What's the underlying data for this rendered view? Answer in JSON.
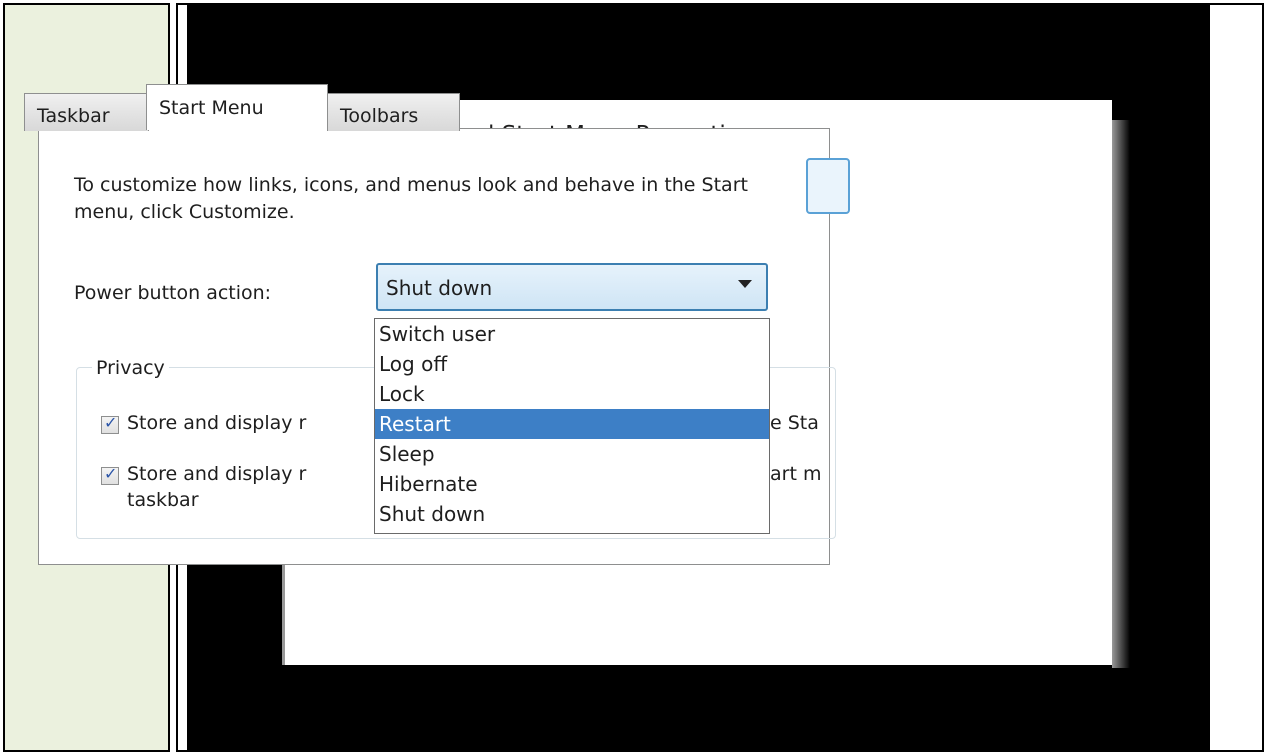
{
  "dialog": {
    "title": "Taskbar and Start Menu Properties",
    "tabs": [
      {
        "label": "Taskbar",
        "active": false
      },
      {
        "label": "Start Menu",
        "active": true
      },
      {
        "label": "Toolbars",
        "active": false
      }
    ],
    "description": "To customize how links, icons, and menus look and behave in the Start menu, click Customize.",
    "power_button": {
      "label": "Power button action:",
      "selected": "Shut down",
      "options": [
        "Switch user",
        "Log off",
        "Lock",
        "Restart",
        "Sleep",
        "Hibernate",
        "Shut down"
      ],
      "highlighted": "Restart"
    },
    "privacy": {
      "legend": "Privacy",
      "checkbox1": {
        "checked": true,
        "label_left": "Store and display r",
        "label_right": "e Sta"
      },
      "checkbox2": {
        "checked": true,
        "label_left": "Store and display r",
        "label_right": "art m",
        "label_wrap": "taskbar"
      }
    }
  },
  "colors": {
    "left_cell": "#ebf1de",
    "highlight": "#3d7fc6",
    "select_border": "#3c7fb1"
  }
}
